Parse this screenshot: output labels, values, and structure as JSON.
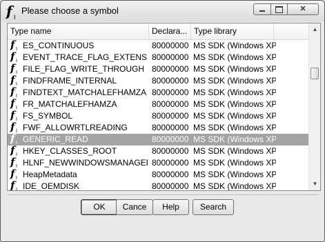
{
  "window": {
    "title": "Please choose a symbol",
    "icon_name": "function-symbol-icon",
    "controls": {
      "minimize": "minimize-button",
      "maximize": "maximize-button",
      "close": "✕"
    }
  },
  "list": {
    "columns": [
      {
        "label": "Type name"
      },
      {
        "label": "Declara..."
      },
      {
        "label": "Type library"
      },
      {
        "label": ""
      }
    ],
    "rows": [
      {
        "name": "ES_CONTINUOUS",
        "decl": "80000000",
        "lib": "MS SDK (Windows XP)",
        "selected": false
      },
      {
        "name": "EVENT_TRACE_FLAG_EXTENSION",
        "decl": "80000000",
        "lib": "MS SDK (Windows XP)",
        "selected": false
      },
      {
        "name": "FILE_FLAG_WRITE_THROUGH",
        "decl": "80000000",
        "lib": "MS SDK (Windows XP)",
        "selected": false
      },
      {
        "name": "FINDFRAME_INTERNAL",
        "decl": "80000000",
        "lib": "MS SDK (Windows XP)",
        "selected": false
      },
      {
        "name": "FINDTEXT_MATCHALEFHAMZA",
        "decl": "80000000",
        "lib": "MS SDK (Windows XP)",
        "selected": false
      },
      {
        "name": "FR_MATCHALEFHAMZA",
        "decl": "80000000",
        "lib": "MS SDK (Windows XP)",
        "selected": false
      },
      {
        "name": "FS_SYMBOL",
        "decl": "80000000",
        "lib": "MS SDK (Windows XP)",
        "selected": false
      },
      {
        "name": "FWF_ALLOWRTLREADING",
        "decl": "80000000",
        "lib": "MS SDK (Windows XP)",
        "selected": false
      },
      {
        "name": "GENERIC_READ",
        "decl": "80000000",
        "lib": "MS SDK (Windows XP)",
        "selected": true
      },
      {
        "name": "HKEY_CLASSES_ROOT",
        "decl": "80000000",
        "lib": "MS SDK (Windows XP)",
        "selected": false
      },
      {
        "name": "HLNF_NEWWINDOWSMANAGED",
        "decl": "80000000",
        "lib": "MS SDK (Windows XP)",
        "selected": false
      },
      {
        "name": "HeapMetadata",
        "decl": "80000000",
        "lib": "MS SDK (Windows XP)",
        "selected": false
      },
      {
        "name": "IDE_OEMDISK",
        "decl": "80000000",
        "lib": "MS SDK (Windows XP)",
        "selected": false
      }
    ],
    "row_icon": "function-symbol-icon",
    "selection_color": "#a3a3a3"
  },
  "buttons": {
    "ok": "OK",
    "cancel": "Cance",
    "help": "Help",
    "search": "Search"
  }
}
